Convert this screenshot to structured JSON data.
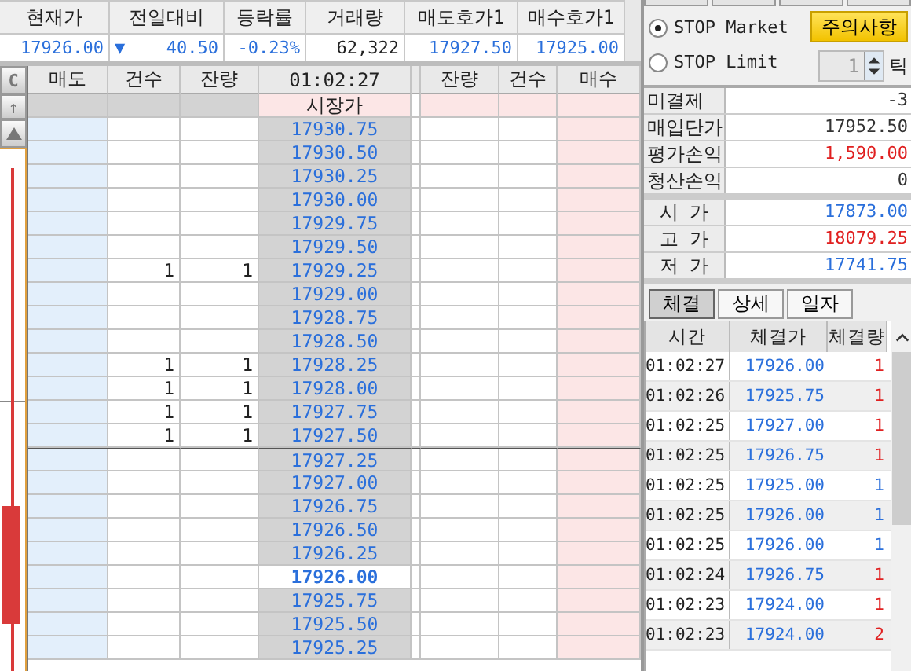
{
  "summary": {
    "columns": [
      {
        "label": "현재가",
        "value": "17926.00"
      },
      {
        "label": "전일대비",
        "value": "40.50",
        "direction_icon": "▼"
      },
      {
        "label": "등락률",
        "value": "-0.23%"
      },
      {
        "label": "거래량",
        "value": "62,322",
        "kind": "plain"
      },
      {
        "label": "매도호가1",
        "value": "17927.50"
      },
      {
        "label": "매수호가1",
        "value": "17925.00"
      }
    ]
  },
  "orderbook": {
    "corner_button": "C",
    "scroll_up": "↑",
    "columns": [
      "매도",
      "건수",
      "잔량",
      "01:02:27",
      "잔량",
      "건수",
      "매수"
    ],
    "market_row": {
      "label": "시장가"
    },
    "asks": [
      {
        "price": "17930.75",
        "current": false
      },
      {
        "price": "17930.50",
        "current": false
      },
      {
        "price": "17930.25",
        "current": false
      },
      {
        "price": "17930.00",
        "current": false
      },
      {
        "price": "17929.75",
        "current": false
      },
      {
        "price": "17929.50",
        "current": false
      },
      {
        "price": "17929.25",
        "sell_count": "1",
        "sell_qty": "1",
        "current": false
      },
      {
        "price": "17929.00",
        "current": false
      },
      {
        "price": "17928.75",
        "current": false
      },
      {
        "price": "17928.50",
        "current": false
      },
      {
        "price": "17928.25",
        "sell_count": "1",
        "sell_qty": "1",
        "current": false
      },
      {
        "price": "17928.00",
        "sell_count": "1",
        "sell_qty": "1",
        "current": false
      },
      {
        "price": "17927.75",
        "sell_count": "1",
        "sell_qty": "1",
        "current": false
      },
      {
        "price": "17927.50",
        "sell_count": "1",
        "sell_qty": "1",
        "current": false
      }
    ],
    "bids": [
      {
        "price": "17927.25",
        "current": false
      },
      {
        "price": "17927.00",
        "current": false
      },
      {
        "price": "17926.75",
        "current": false
      },
      {
        "price": "17926.50",
        "current": false
      },
      {
        "price": "17926.25",
        "current": false
      },
      {
        "price": "17926.00",
        "current": true
      },
      {
        "price": "17925.75",
        "current": false
      },
      {
        "price": "17925.50",
        "current": false
      },
      {
        "price": "17925.25",
        "current": false
      }
    ]
  },
  "order_panel": {
    "stop_options": [
      {
        "label": "STOP Market",
        "selected": true
      },
      {
        "label": "STOP Limit",
        "selected": false
      }
    ],
    "warning_button": "주의사항",
    "tick_value": "1",
    "tick_unit": "틱"
  },
  "position": [
    {
      "label": "미결제",
      "value": "-3"
    },
    {
      "label": "매입단가",
      "value": "17952.50"
    },
    {
      "label": "평가손익",
      "value": "1,590.00",
      "color": "#e02020"
    },
    {
      "label": "청산손익",
      "value": "0"
    }
  ],
  "prices": [
    {
      "label": "시 가",
      "value": "17873.00",
      "color": "#2a6fdb"
    },
    {
      "label": "고 가",
      "value": "18079.25",
      "color": "#e02020"
    },
    {
      "label": "저 가",
      "value": "17741.75",
      "color": "#2a6fdb"
    }
  ],
  "tabs": [
    {
      "label": "체결",
      "selected": true
    },
    {
      "label": "상세",
      "selected": false
    },
    {
      "label": "일자",
      "selected": false
    }
  ],
  "trades": {
    "columns": [
      "시간",
      "체결가",
      "체결량"
    ],
    "rows": [
      {
        "time": "01:02:27",
        "price": "17926.00",
        "qty": "1",
        "color": "#e02020"
      },
      {
        "time": "01:02:26",
        "price": "17925.75",
        "qty": "1",
        "color": "#e02020"
      },
      {
        "time": "01:02:25",
        "price": "17927.00",
        "qty": "1",
        "color": "#e02020"
      },
      {
        "time": "01:02:25",
        "price": "17926.75",
        "qty": "1",
        "color": "#e02020"
      },
      {
        "time": "01:02:25",
        "price": "17925.00",
        "qty": "1",
        "color": "#2a6fdb"
      },
      {
        "time": "01:02:25",
        "price": "17926.00",
        "qty": "1",
        "color": "#2a6fdb"
      },
      {
        "time": "01:02:25",
        "price": "17926.00",
        "qty": "1",
        "color": "#2a6fdb"
      },
      {
        "time": "01:02:24",
        "price": "17926.75",
        "qty": "1",
        "color": "#e02020"
      },
      {
        "time": "01:02:23",
        "price": "17924.00",
        "qty": "1",
        "color": "#e02020"
      },
      {
        "time": "01:02:23",
        "price": "17924.00",
        "qty": "2",
        "color": "#e02020"
      }
    ]
  }
}
